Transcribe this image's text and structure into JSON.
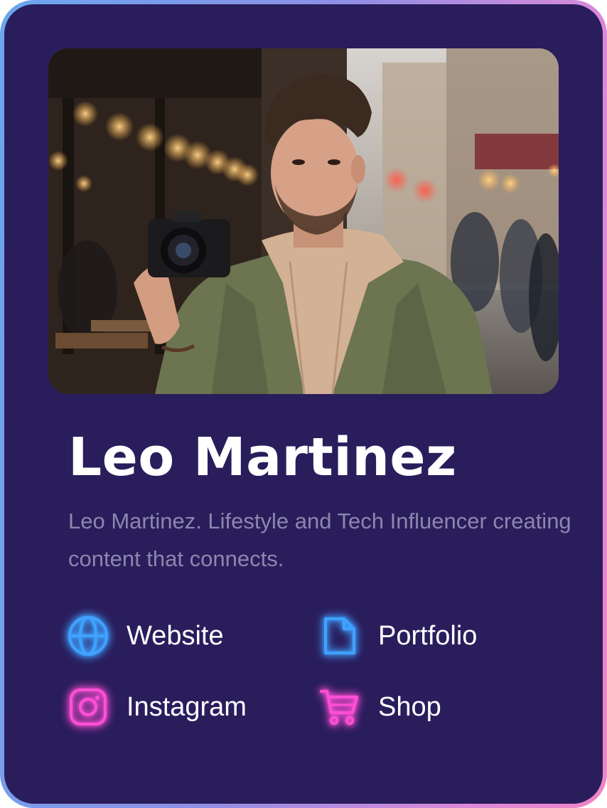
{
  "profile": {
    "name": "Leo Martinez",
    "bio": "Leo Martinez. Lifestyle and Tech Influencer creating content that connects.",
    "photo_alt": "Portrait of Leo Martinez holding a camera on a city street"
  },
  "links": [
    {
      "label": "Website",
      "icon": "globe-icon",
      "color": "#3fa2ff"
    },
    {
      "label": "Portfolio",
      "icon": "document-icon",
      "color": "#3fa2ff"
    },
    {
      "label": "Instagram",
      "icon": "instagram-icon",
      "color": "#ff4fd6"
    },
    {
      "label": "Shop",
      "icon": "cart-icon",
      "color": "#ff4fd6"
    }
  ],
  "colors": {
    "card_background": "#2a1d5c",
    "border_gradient_start": "#6aa7ee",
    "border_gradient_end": "#ee86c6",
    "bio_text": "#8d86ad",
    "accent_blue": "#3fa2ff",
    "accent_pink": "#ff4fd6"
  }
}
